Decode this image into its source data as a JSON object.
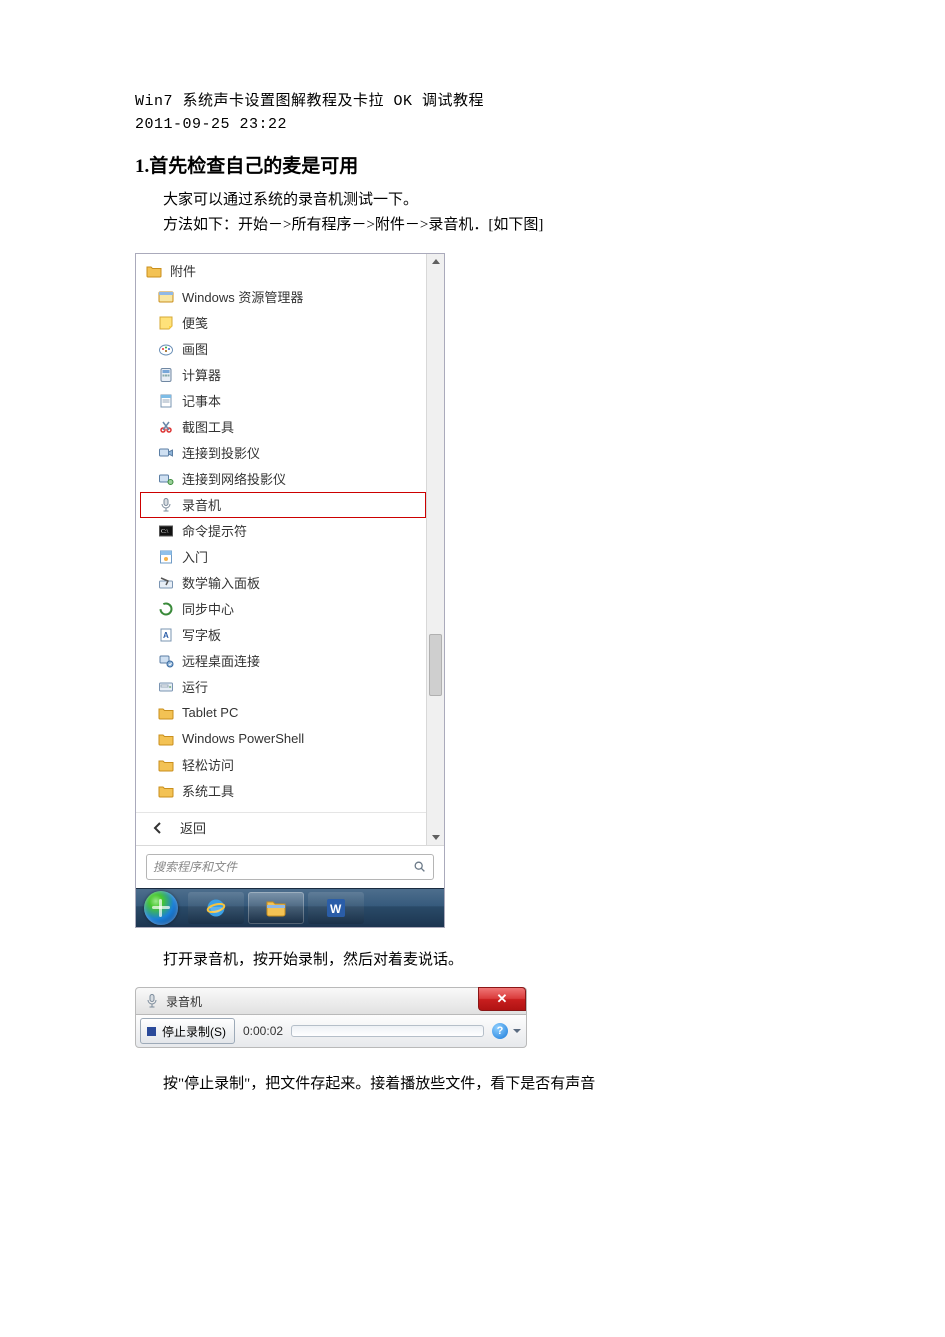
{
  "article": {
    "title": "Win7 系统声卡设置图解教程及卡拉 OK 调试教程",
    "timestamp": "2011-09-25 23:22",
    "h1": "1.首先检查自己的麦是可用",
    "p1": "大家可以通过系统的录音机测试一下。",
    "p2": "方法如下：开始－>所有程序－>附件－>录音机．[如下图]",
    "p3": "打开录音机，按开始录制，然后对着麦说话。",
    "p4": "按\"停止录制\"，把文件存起来。接着播放些文件，看下是否有声音"
  },
  "start_menu": {
    "folder": "附件",
    "items": [
      {
        "label": "Windows 资源管理器",
        "icon": "explorer-icon"
      },
      {
        "label": "便笺",
        "icon": "sticky-note-icon"
      },
      {
        "label": "画图",
        "icon": "paint-icon"
      },
      {
        "label": "计算器",
        "icon": "calculator-icon"
      },
      {
        "label": "记事本",
        "icon": "notepad-icon"
      },
      {
        "label": "截图工具",
        "icon": "snip-icon"
      },
      {
        "label": "连接到投影仪",
        "icon": "projector-icon"
      },
      {
        "label": "连接到网络投影仪",
        "icon": "net-projector-icon"
      },
      {
        "label": "录音机",
        "icon": "mic-icon",
        "highlighted": true
      },
      {
        "label": "命令提示符",
        "icon": "cmd-icon"
      },
      {
        "label": "入门",
        "icon": "getting-started-icon"
      },
      {
        "label": "数学输入面板",
        "icon": "math-input-icon"
      },
      {
        "label": "同步中心",
        "icon": "sync-icon"
      },
      {
        "label": "写字板",
        "icon": "wordpad-icon"
      },
      {
        "label": "远程桌面连接",
        "icon": "rdp-icon"
      },
      {
        "label": "运行",
        "icon": "run-icon"
      },
      {
        "label": "Tablet PC",
        "icon": "folder-icon"
      },
      {
        "label": "Windows PowerShell",
        "icon": "folder-icon"
      },
      {
        "label": "轻松访问",
        "icon": "folder-icon"
      },
      {
        "label": "系统工具",
        "icon": "folder-icon"
      }
    ],
    "back": "返回",
    "search_placeholder": "搜索程序和文件",
    "taskbar": [
      {
        "icon": "ie-icon"
      },
      {
        "icon": "explorer-tb-icon"
      },
      {
        "icon": "word-icon"
      }
    ]
  },
  "recorder": {
    "title": "录音机",
    "stop_label": "停止录制(S)",
    "time": "0:00:02"
  }
}
